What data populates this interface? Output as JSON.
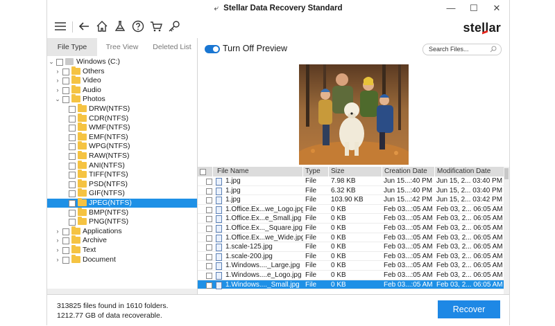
{
  "window": {
    "title": "Stellar Data Recovery Standard",
    "undo_glyph": "⤶"
  },
  "window_controls": {
    "minimize": "—",
    "maximize": "☐",
    "close": "✕"
  },
  "brand": {
    "logo_pre": "ste",
    "logo_mid": "ll",
    "logo_post": "ar",
    "accent": "#e2231a"
  },
  "tabs": [
    "File Type",
    "Tree View",
    "Deleted List"
  ],
  "tree": [
    {
      "label": "Windows (C:)",
      "expand": "⌄",
      "level": 0,
      "drive": true
    },
    {
      "label": "Others",
      "expand": "›",
      "level": 1
    },
    {
      "label": "Video",
      "expand": "›",
      "level": 1
    },
    {
      "label": "Audio",
      "expand": "›",
      "level": 1
    },
    {
      "label": "Photos",
      "expand": "⌄",
      "level": 1
    },
    {
      "label": "DRW(NTFS)",
      "expand": "",
      "level": 2
    },
    {
      "label": "CDR(NTFS)",
      "expand": "",
      "level": 2
    },
    {
      "label": "WMF(NTFS)",
      "expand": "",
      "level": 2
    },
    {
      "label": "EMF(NTFS)",
      "expand": "",
      "level": 2
    },
    {
      "label": "WPG(NTFS)",
      "expand": "",
      "level": 2
    },
    {
      "label": "RAW(NTFS)",
      "expand": "",
      "level": 2
    },
    {
      "label": "ANI(NTFS)",
      "expand": "",
      "level": 2
    },
    {
      "label": "TIFF(NTFS)",
      "expand": "",
      "level": 2
    },
    {
      "label": "PSD(NTFS)",
      "expand": "",
      "level": 2
    },
    {
      "label": "GIF(NTFS)",
      "expand": "",
      "level": 2
    },
    {
      "label": "JPEG(NTFS)",
      "expand": "",
      "level": 2,
      "selected": true
    },
    {
      "label": "BMP(NTFS)",
      "expand": "",
      "level": 2
    },
    {
      "label": "PNG(NTFS)",
      "expand": "",
      "level": 2
    },
    {
      "label": "Applications",
      "expand": "›",
      "level": 1
    },
    {
      "label": "Archive",
      "expand": "›",
      "level": 1
    },
    {
      "label": "Text",
      "expand": "›",
      "level": 1
    },
    {
      "label": "Document",
      "expand": "›",
      "level": 1
    }
  ],
  "preview": {
    "toggle_label": "Turn Off Preview",
    "toggle_on": true
  },
  "search": {
    "placeholder": "Search Files..."
  },
  "table": {
    "columns": [
      "File Name",
      "Type",
      "Size",
      "Creation Date",
      "Modification Date"
    ],
    "rows": [
      {
        "name": "1.jpg",
        "type": "File",
        "size": "7.98 KB",
        "created": "Jun 15...:40 PM",
        "modified": "Jun 15, 2... 03:40 PM"
      },
      {
        "name": "1.jpg",
        "type": "File",
        "size": "6.32 KB",
        "created": "Jun 15...:40 PM",
        "modified": "Jun 15, 2... 03:40 PM"
      },
      {
        "name": "1.jpg",
        "type": "File",
        "size": "103.90 KB",
        "created": "Jun 15...:42 PM",
        "modified": "Jun 15, 2... 03:42 PM"
      },
      {
        "name": "1.Office.Ex...we_Logo.jpg",
        "type": "File",
        "size": "0 KB",
        "created": "Feb 03...:05 AM",
        "modified": "Feb 03, 2... 06:05 AM"
      },
      {
        "name": "1.Office.Ex...e_Small.jpg",
        "type": "File",
        "size": "0 KB",
        "created": "Feb 03...:05 AM",
        "modified": "Feb 03, 2... 06:05 AM"
      },
      {
        "name": "1.Office.Ex..._Square.jpg",
        "type": "File",
        "size": "0 KB",
        "created": "Feb 03...:05 AM",
        "modified": "Feb 03, 2... 06:05 AM"
      },
      {
        "name": "1.Office.Ex...we_Wide.jpg",
        "type": "File",
        "size": "0 KB",
        "created": "Feb 03...:05 AM",
        "modified": "Feb 03, 2... 06:05 AM"
      },
      {
        "name": "1.scale-125.jpg",
        "type": "File",
        "size": "0 KB",
        "created": "Feb 03...:05 AM",
        "modified": "Feb 03, 2... 06:05 AM"
      },
      {
        "name": "1.scale-200.jpg",
        "type": "File",
        "size": "0 KB",
        "created": "Feb 03...:05 AM",
        "modified": "Feb 03, 2... 06:05 AM"
      },
      {
        "name": "1.Windows...._Large.jpg",
        "type": "File",
        "size": "0 KB",
        "created": "Feb 03...:05 AM",
        "modified": "Feb 03, 2... 06:05 AM"
      },
      {
        "name": "1.Windows....e_Logo.jpg",
        "type": "File",
        "size": "0 KB",
        "created": "Feb 03...:05 AM",
        "modified": "Feb 03, 2... 06:05 AM"
      },
      {
        "name": "1.Windows...._Small.jpg",
        "type": "File",
        "size": "0 KB",
        "created": "Feb 03...:05 AM",
        "modified": "Feb 03, 2... 06:05 AM",
        "selected": true
      }
    ]
  },
  "status": {
    "files_found": "313825 files found in 1610 folders.",
    "recoverable": "1212.77 GB of data recoverable."
  },
  "recover_button": "Recover",
  "colors": {
    "accent": "#1e88e5",
    "selection": "#1e90e6",
    "folder": "#f5c342"
  },
  "icons": [
    "menu-icon",
    "back-icon",
    "home-icon",
    "scan-icon",
    "help-icon",
    "cart-icon",
    "key-icon",
    "search-icon"
  ]
}
